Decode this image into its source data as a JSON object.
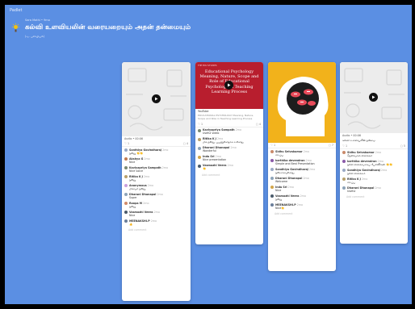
{
  "app": {
    "brand": "Padlet"
  },
  "header": {
    "breadcrumb": "Sara Mathi • 9mo",
    "title": "கல்வி உளவியலின் வரையறையும் அதன் தன்மையும்",
    "subtitle": "(வ. புவியியல்)"
  },
  "columns": [
    {
      "caption": "Audio • 00:06",
      "like_count": "1",
      "comment_count": "4",
      "comments": [
        {
          "name": "Santhiya Govindharaj",
          "time": "2mo",
          "text": "நன்று 👏👏",
          "avatar": "#9aa9c4"
        },
        {
          "name": "Akshya G",
          "time": "2mo",
          "text": "Nice",
          "avatar": "#c07b52"
        },
        {
          "name": "Kaviyapriya Sampath",
          "time": "2mo",
          "text": "Nice voice",
          "avatar": "#7a8a73"
        },
        {
          "name": "Ritika K J",
          "time": "2mo",
          "text": "நன்று",
          "avatar": "#b8a06b"
        },
        {
          "name": "Anonymous",
          "time": "2mo",
          "text": "மிகவும் நன்று",
          "avatar": "#c9a0dc"
        },
        {
          "name": "Dharani Dhanapal",
          "time": "2mo",
          "text": "Super",
          "avatar": "#8da3b8"
        },
        {
          "name": "Roopa M",
          "time": "2mo",
          "text": "நன்று",
          "avatar": "#d08a6a"
        },
        {
          "name": "Vasmozhi Veera",
          "time": "2mo",
          "text": "Nice",
          "avatar": "#4a5a6a"
        },
        {
          "name": "MEENAKSHI.P",
          "time": "2mo",
          "text": "👍",
          "avatar": "#6a7e9a"
        }
      ],
      "add_comment": "Add comment"
    },
    {
      "thumb_text": "Educational Psychology Meaning, Nature, Scope and Role of Educational Psychology in Teaching Learning Process",
      "thumb_tag": "THE EDU STUDIES",
      "source": "YouTube",
      "desc": "EDUCATIONAL PSYCHOLOGY Meaning, Nature, Scope and Role in Teaching Learning Process",
      "like_count": "1",
      "comment_count": "4",
      "comments": [
        {
          "name": "Kaviyapriya Sampath",
          "time": "2mo",
          "text": "Useful video",
          "avatar": "#7a8a73"
        },
        {
          "name": "Ritika K J",
          "time": "2mo",
          "text": "மிக நன்று, பயனுள்ளதாக உள்ளது",
          "avatar": "#b8a06b"
        },
        {
          "name": "Dharani Dhanapal",
          "time": "2mo",
          "text": "Wonderful",
          "avatar": "#8da3b8"
        },
        {
          "name": "Indu Sri",
          "time": "2mo",
          "text": "Nice presentation",
          "avatar": "#d2a64b"
        },
        {
          "name": "Vasmozhi Veera",
          "time": "2mo",
          "text": "👏",
          "avatar": "#4a5a6a"
        }
      ],
      "add_comment": "Add comment"
    },
    {
      "like_count": "1",
      "comment_count": "7",
      "comments": [
        {
          "name": "Sidhu Selvakumar",
          "time": "2mo",
          "text": "சிறப்பு",
          "avatar": "#c98a6a"
        },
        {
          "name": "karthika devendran",
          "time": "2mo",
          "text": "Simple and Best Presentation",
          "avatar": "#8a5aa8"
        },
        {
          "name": "Sandhiya Govindharaj",
          "time": "2mo",
          "text": "நன்றாகவுள்ளது",
          "avatar": "#9aa9c4"
        },
        {
          "name": "Dharani Dhanapal",
          "time": "2mo",
          "text": "Welcome",
          "avatar": "#8da3b8"
        },
        {
          "name": "Indu Sri",
          "time": "2mo",
          "text": "Nice",
          "avatar": "#d2a64b"
        },
        {
          "name": "Vasmozhi Veera",
          "time": "2mo",
          "text": "நன்று",
          "avatar": "#4a5a6a"
        },
        {
          "name": "MEENAKSHI.P",
          "time": "2mo",
          "text": "Nice👏",
          "avatar": "#6a7e9a"
        }
      ],
      "add_comment": "Add comment"
    },
    {
      "caption": "Audio • 00:06",
      "title": "கல்வி உளவியலின் தன்மை",
      "like_count": "1",
      "comment_count": "5",
      "comments": [
        {
          "name": "Sidhu Selvakumar",
          "time": "2mo",
          "text": "தெளிவான விளக்கம்",
          "avatar": "#c98a6a"
        },
        {
          "name": "karthika devendran",
          "time": "2mo",
          "text": "நல்ல விளக்கமாகப் பேசினீர்கள் 👏👏",
          "avatar": "#8a5aa8"
        },
        {
          "name": "Sandhiya Govindharaj",
          "time": "2mo",
          "text": "நல்ல விளக்கம்",
          "avatar": "#9aa9c4"
        },
        {
          "name": "Ritika K J",
          "time": "2mo",
          "text": "சிறப்பு",
          "avatar": "#b8a06b"
        },
        {
          "name": "Dharani Dhanapal",
          "time": "2mo",
          "text": "Useful",
          "avatar": "#8da3b8"
        }
      ],
      "add_comment": "Add comment"
    }
  ]
}
